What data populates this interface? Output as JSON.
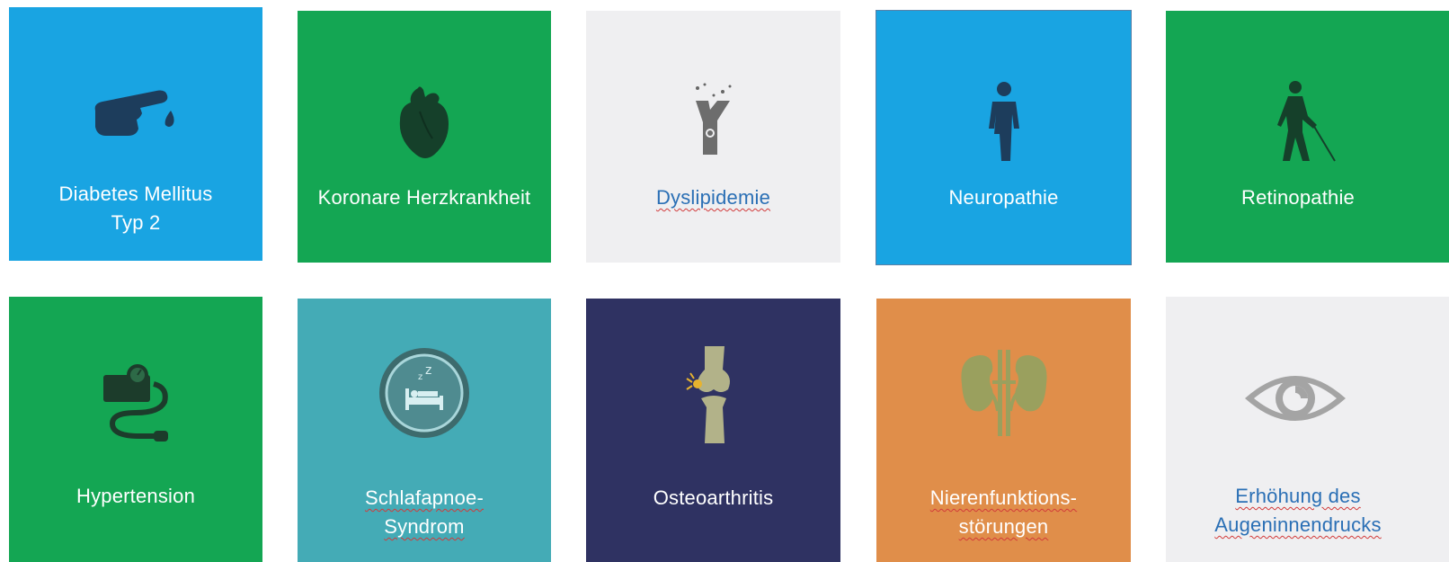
{
  "tiles": [
    {
      "id": "diabetes",
      "lines": [
        "Diabetes Mellitus",
        "Typ 2"
      ],
      "icon": "finger-blood-drop-icon",
      "color": "#19a4e2"
    },
    {
      "id": "koronare",
      "lines": [
        "Koronare Herzkrankheit"
      ],
      "icon": "heart-icon",
      "color": "#14a653"
    },
    {
      "id": "dyslipidemie",
      "lines": [
        "Dyslipidemie"
      ],
      "icon": "artery-plaque-icon",
      "color": "#efeff1"
    },
    {
      "id": "neuropathie",
      "lines": [
        "Neuropathie"
      ],
      "icon": "person-amputee-icon",
      "color": "#19a4e2"
    },
    {
      "id": "retinopathie",
      "lines": [
        "Retinopathie"
      ],
      "icon": "blind-person-cane-icon",
      "color": "#14a653"
    },
    {
      "id": "hypertension",
      "lines": [
        "Hypertension"
      ],
      "icon": "blood-pressure-monitor-icon",
      "color": "#14a653"
    },
    {
      "id": "schlafapnoe",
      "lines": [
        "Schlafapnoe-",
        "Syndrom"
      ],
      "icon": "sleeping-bed-icon",
      "color": "#44abb6"
    },
    {
      "id": "osteoarthritis",
      "lines": [
        "Osteoarthritis"
      ],
      "icon": "knee-joint-icon",
      "color": "#2f3262"
    },
    {
      "id": "nieren",
      "lines": [
        "Nierenfunktions-",
        "störungen"
      ],
      "icon": "kidneys-icon",
      "color": "#e08e4a"
    },
    {
      "id": "augeninnendruck",
      "lines": [
        "Erhöhung des",
        "Augeninnendrucks"
      ],
      "icon": "eye-icon",
      "color": "#efeff1"
    }
  ]
}
